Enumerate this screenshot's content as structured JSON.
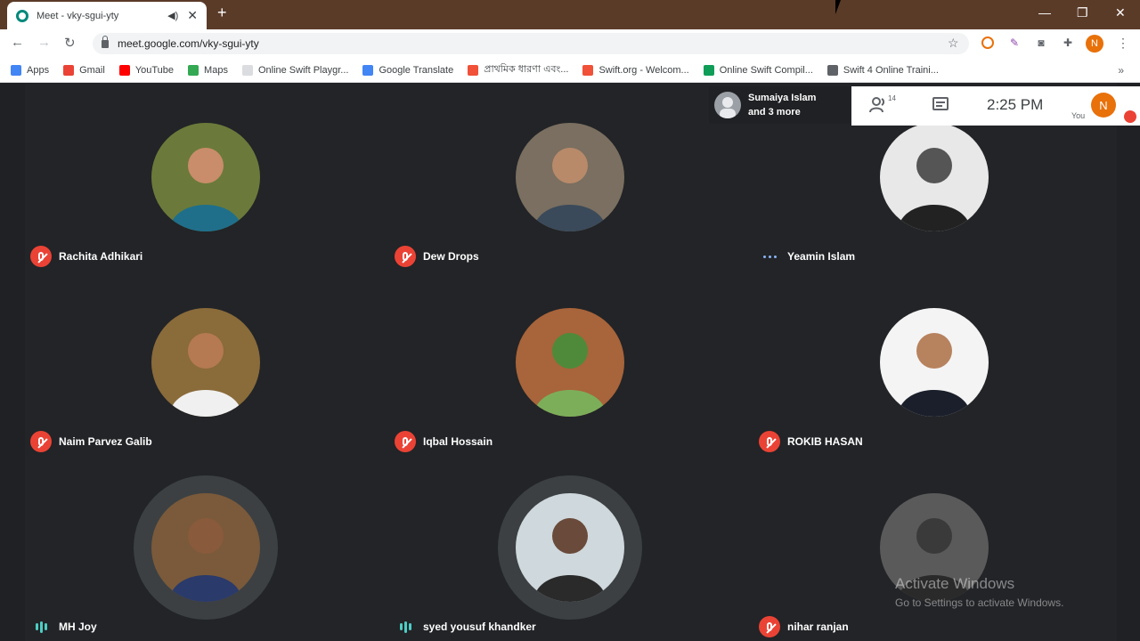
{
  "browser": {
    "tab_title": "Meet - vky-sgui-yty",
    "new_tab": "+",
    "url": "meet.google.com/vky-sgui-yty",
    "profile_initial": "N"
  },
  "bookmarks": [
    {
      "label": "Apps",
      "icon": "apps-grid-icon",
      "color": "#4285f4"
    },
    {
      "label": "Gmail",
      "icon": "gmail-icon",
      "color": "#ea4335"
    },
    {
      "label": "YouTube",
      "icon": "youtube-icon",
      "color": "#ff0000"
    },
    {
      "label": "Maps",
      "icon": "maps-icon",
      "color": "#34a853"
    },
    {
      "label": "Online Swift Playgr...",
      "icon": "page-icon",
      "color": "#dadce0"
    },
    {
      "label": "Google Translate",
      "icon": "translate-icon",
      "color": "#4285f4"
    },
    {
      "label": "প্রাথমিক ধারণা এবং...",
      "icon": "swift-icon",
      "color": "#f05138"
    },
    {
      "label": "Swift.org - Welcom...",
      "icon": "swift-org-icon",
      "color": "#f05138"
    },
    {
      "label": "Online Swift Compil...",
      "icon": "code-icon",
      "color": "#0f9d58"
    },
    {
      "label": "Swift 4 Online Traini...",
      "icon": "diamond-icon",
      "color": "#5f6368"
    }
  ],
  "meet": {
    "presenter": {
      "line1": "Sumaiya Islam",
      "line2": "and 3 more"
    },
    "participant_count": "14",
    "time": "2:25 PM",
    "you_label": "You",
    "you_initial": "N",
    "participants": [
      {
        "name": "Rachita Adhikari",
        "status": "muted",
        "bg": "#6b7a3a",
        "skin": "#c98d6b",
        "shirt": "#1f6f8b"
      },
      {
        "name": "Dew Drops",
        "status": "muted",
        "bg": "#7a6f60",
        "skin": "#b88a6a",
        "shirt": "#3b4a5a"
      },
      {
        "name": "Yeamin Islam",
        "status": "connecting",
        "bg": "#e8e8e8",
        "skin": "#555555",
        "shirt": "#222222"
      },
      {
        "name": "Naim Parvez Galib",
        "status": "muted",
        "bg": "#8a6b3a",
        "skin": "#b57a52",
        "shirt": "#f0f0f0"
      },
      {
        "name": "Iqbal Hossain",
        "status": "muted",
        "bg": "#a8643a",
        "skin": "#4f8a3a",
        "shirt": "#7cae5a"
      },
      {
        "name": "ROKIB HASAN",
        "status": "muted",
        "bg": "#f4f4f4",
        "skin": "#b7825e",
        "shirt": "#1b1f2b"
      },
      {
        "name": "MH Joy",
        "status": "speaking",
        "bg": "#7a5a3a",
        "skin": "#8a5a3c",
        "shirt": "#2a3a6a"
      },
      {
        "name": "syed yousuf khandker",
        "status": "speaking",
        "bg": "#cfd8dc",
        "skin": "#6a4a3a",
        "shirt": "#2a2a2a"
      },
      {
        "name": "nihar ranjan",
        "status": "muted",
        "bg": "#5a5a5a",
        "skin": "#3a3a3a",
        "shirt": "#2a2a2a"
      }
    ]
  },
  "watermark": {
    "line1": "Activate Windows",
    "line2": "Go to Settings to activate Windows."
  }
}
